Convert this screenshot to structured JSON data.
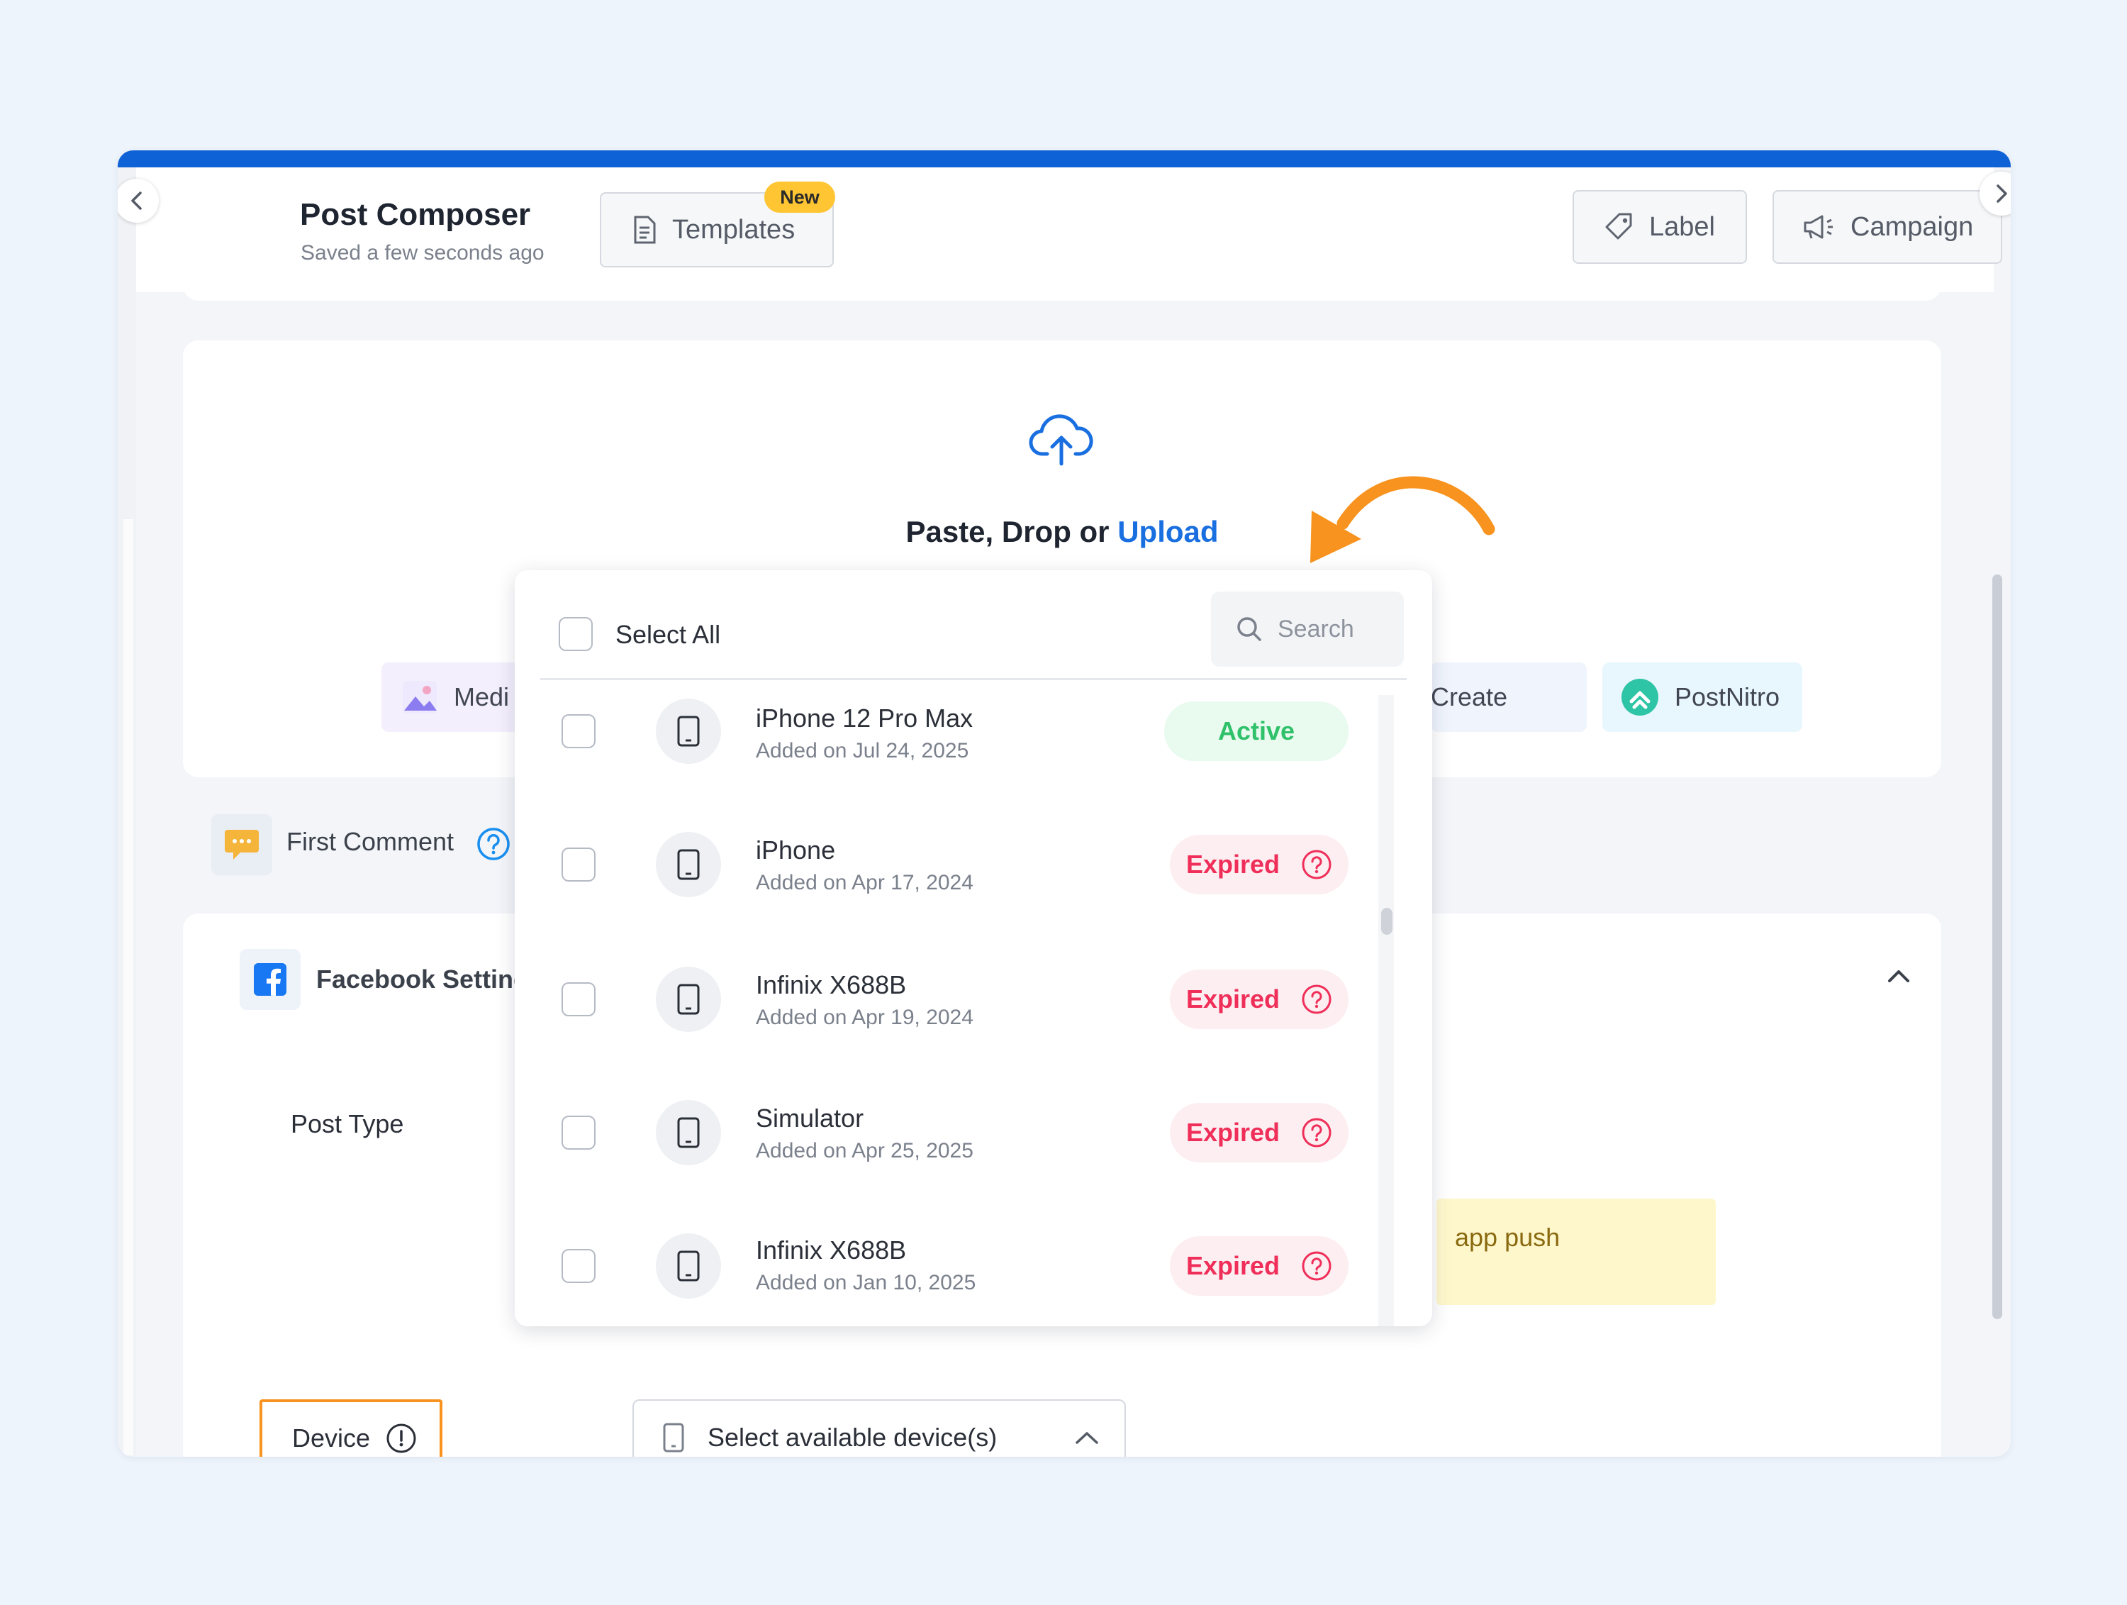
{
  "header": {
    "title": "Post Composer",
    "subtitle": "Saved a few seconds ago",
    "templates_label": "Templates",
    "new_badge": "New",
    "label_button": "Label",
    "campaign_button": "Campaign"
  },
  "upload": {
    "prefix": "Paste, Drop or",
    "link": "Upload"
  },
  "media_chips": {
    "media_label": "Medi",
    "create_label": "Create",
    "postnitro_label": "PostNitro"
  },
  "first_comment": {
    "label": "First Comment"
  },
  "facebook": {
    "title": "Facebook Setting",
    "post_type_label": "Post Type",
    "note_fragment": "app push",
    "device_label": "Device",
    "device_placeholder": "Select available device(s)"
  },
  "device_dropdown": {
    "select_all": "Select All",
    "search_placeholder": "Search",
    "devices": [
      {
        "name": "iPhone 12 Pro Max",
        "added": "Added on Jul 24, 2025",
        "status": "Active"
      },
      {
        "name": "iPhone",
        "added": "Added on Apr 17, 2024",
        "status": "Expired"
      },
      {
        "name": "Infinix X688B",
        "added": "Added on Apr 19, 2024",
        "status": "Expired"
      },
      {
        "name": "Simulator",
        "added": "Added on Apr 25, 2025",
        "status": "Expired"
      },
      {
        "name": "Infinix X688B",
        "added": "Added on Jan 10, 2025",
        "status": "Expired"
      }
    ]
  },
  "colors": {
    "brand_blue": "#0f62d6",
    "link_blue": "#1a6fe0",
    "annotation_orange": "#f7931e",
    "active_green": "#2fc16a",
    "expired_red": "#ef2f59"
  }
}
